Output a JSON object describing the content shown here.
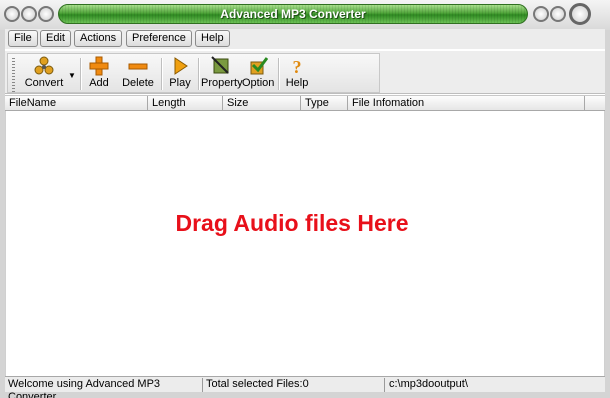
{
  "window": {
    "title": "Advanced MP3 Converter"
  },
  "menu": {
    "items": [
      "File",
      "Edit",
      "Actions",
      "Preference",
      "Help"
    ]
  },
  "toolbar": {
    "convert": "Convert",
    "add": "Add",
    "delete": "Delete",
    "play": "Play",
    "property": "Property",
    "option": "Option",
    "help": "Help"
  },
  "columns": [
    "FileName",
    "Length",
    "Size",
    "Type",
    "File Infomation"
  ],
  "list": {
    "empty_hint": "Drag Audio files Here"
  },
  "status": {
    "welcome": "Welcome using Advanced MP3 Converter",
    "selected": "Total selected Files:0",
    "output_path": "c:\\mp3dooutput\\"
  },
  "colors": {
    "title_green": "#3f9a2e",
    "hint_red": "#e8101a"
  }
}
